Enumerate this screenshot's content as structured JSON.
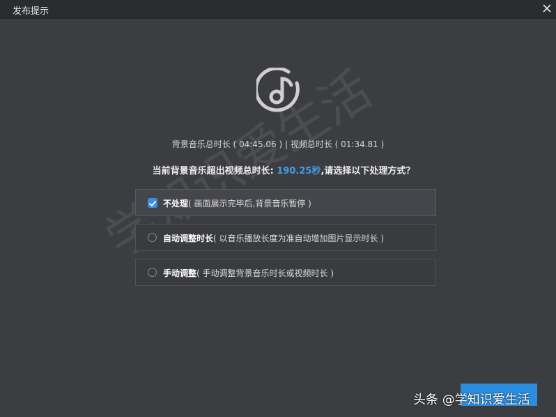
{
  "window": {
    "title": "发布提示",
    "close_icon": "close-icon"
  },
  "main": {
    "icon": "music-note-icon",
    "durations_text": "背景音乐总时长 ( 04:45.06 ) | 视频总时长 ( 01:34.81 )",
    "question_prefix": "当前背景音乐超出视频总时长: ",
    "question_highlight": "190.25秒",
    "question_suffix": ",请选择以下处理方式？",
    "highlight_color": "#3f9de8"
  },
  "options": [
    {
      "title": "不处理",
      "desc": "( 画面展示完毕后,背景音乐暂停 )",
      "selected": true
    },
    {
      "title": "自动调整时长",
      "desc": "( 以音乐播放长度为准自动增加图片显示时长 )",
      "selected": false
    },
    {
      "title": "手动调整",
      "desc": "( 手动调整背景音乐时长或视频时长 )",
      "selected": false
    }
  ],
  "footer": {
    "confirm_label": "",
    "watermark_text": "头条 @学知识爱生活"
  },
  "diagonal_watermark": "学知识爱生活",
  "colors": {
    "background": "#3c3d41",
    "titlebar": "#2b2c2f",
    "accent": "#2a8de0"
  }
}
